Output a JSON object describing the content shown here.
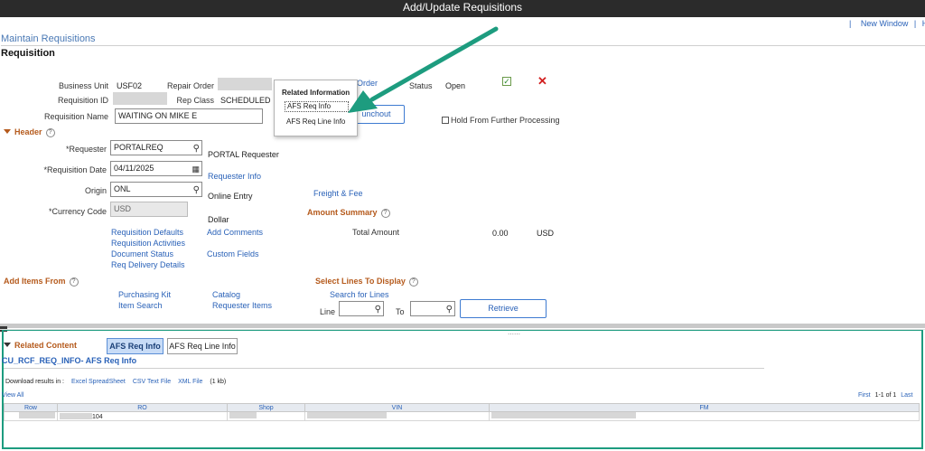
{
  "window": {
    "title": "Add/Update Requisitions"
  },
  "top_links": {
    "new_window": "New Window",
    "sep": "|",
    "help_truncated": "H"
  },
  "breadcrumb": "Maintain Requisitions",
  "page_title": "Requisition",
  "form": {
    "business_unit_label": "Business Unit",
    "business_unit_value": "USF02",
    "repair_order_label": "Repair Order",
    "requisition_id_label": "Requisition ID",
    "rep_class_label": "Rep Class",
    "rep_class_value": "SCHEDULED",
    "requisition_name_label": "Requisition Name",
    "requisition_name_value": "WAITING ON MIKE E",
    "status_label": "Status",
    "status_value": "Open",
    "order_link": "Order",
    "punchout_label": "unchout",
    "hold_label": "Hold From Further Processing"
  },
  "related_popup": {
    "title": "Related Information",
    "items": [
      "AFS Req Info",
      "AFS Req Line Info"
    ]
  },
  "header": {
    "section_label": "Header",
    "requester_label": "*Requester",
    "requester_value": "PORTALREQ",
    "requester_desc": "PORTAL Requester",
    "requester_info_link": "Requester Info",
    "req_date_label": "*Requisition Date",
    "req_date_value": "04/11/2025",
    "origin_label": "Origin",
    "origin_value": "ONL",
    "origin_desc": "Online Entry",
    "freight_link": "Freight & Fee",
    "currency_label": "*Currency Code",
    "currency_value": "USD",
    "currency_desc": "Dollar",
    "amount_summary_label": "Amount Summary",
    "total_amount_label": "Total Amount",
    "total_amount_value": "0.00",
    "total_amount_currency": "USD",
    "links_col1": [
      "Requisition Defaults",
      "Requisition Activities",
      "Document Status",
      "Req Delivery Details"
    ],
    "links_col2": [
      "Add Comments",
      "Custom Fields"
    ]
  },
  "add_items": {
    "section_label": "Add Items From",
    "col1": [
      "Purchasing Kit",
      "Item Search"
    ],
    "col2": [
      "Catalog",
      "Requester Items"
    ]
  },
  "select_lines": {
    "section_label": "Select Lines To Display",
    "search_link": "Search for Lines",
    "line_label": "Line",
    "to_label": "To",
    "retrieve_label": "Retrieve"
  },
  "related_content": {
    "label": "Related Content",
    "tabs": [
      "AFS Req Info",
      "AFS Req Line Info"
    ],
    "grid_title": "CU_RCF_REQ_INFO- AFS Req Info",
    "download_label": "Download results in :",
    "download_links": [
      "Excel SpreadSheet",
      "CSV Text File",
      "XML File"
    ],
    "download_size": "(1 kb)",
    "view_all": "View All",
    "pager": {
      "first": "First",
      "range": "1-1 of 1",
      "last": "Last"
    },
    "columns": [
      "Row",
      "RO",
      "Shop",
      "VIN",
      "FM"
    ],
    "rows": [
      {
        "ro": "104"
      }
    ]
  },
  "colors": {
    "titlebar": "#2b2b2b",
    "link": "#2a62b8",
    "section": "#b55a1c",
    "annotation_arrow": "#1d9c7f"
  }
}
